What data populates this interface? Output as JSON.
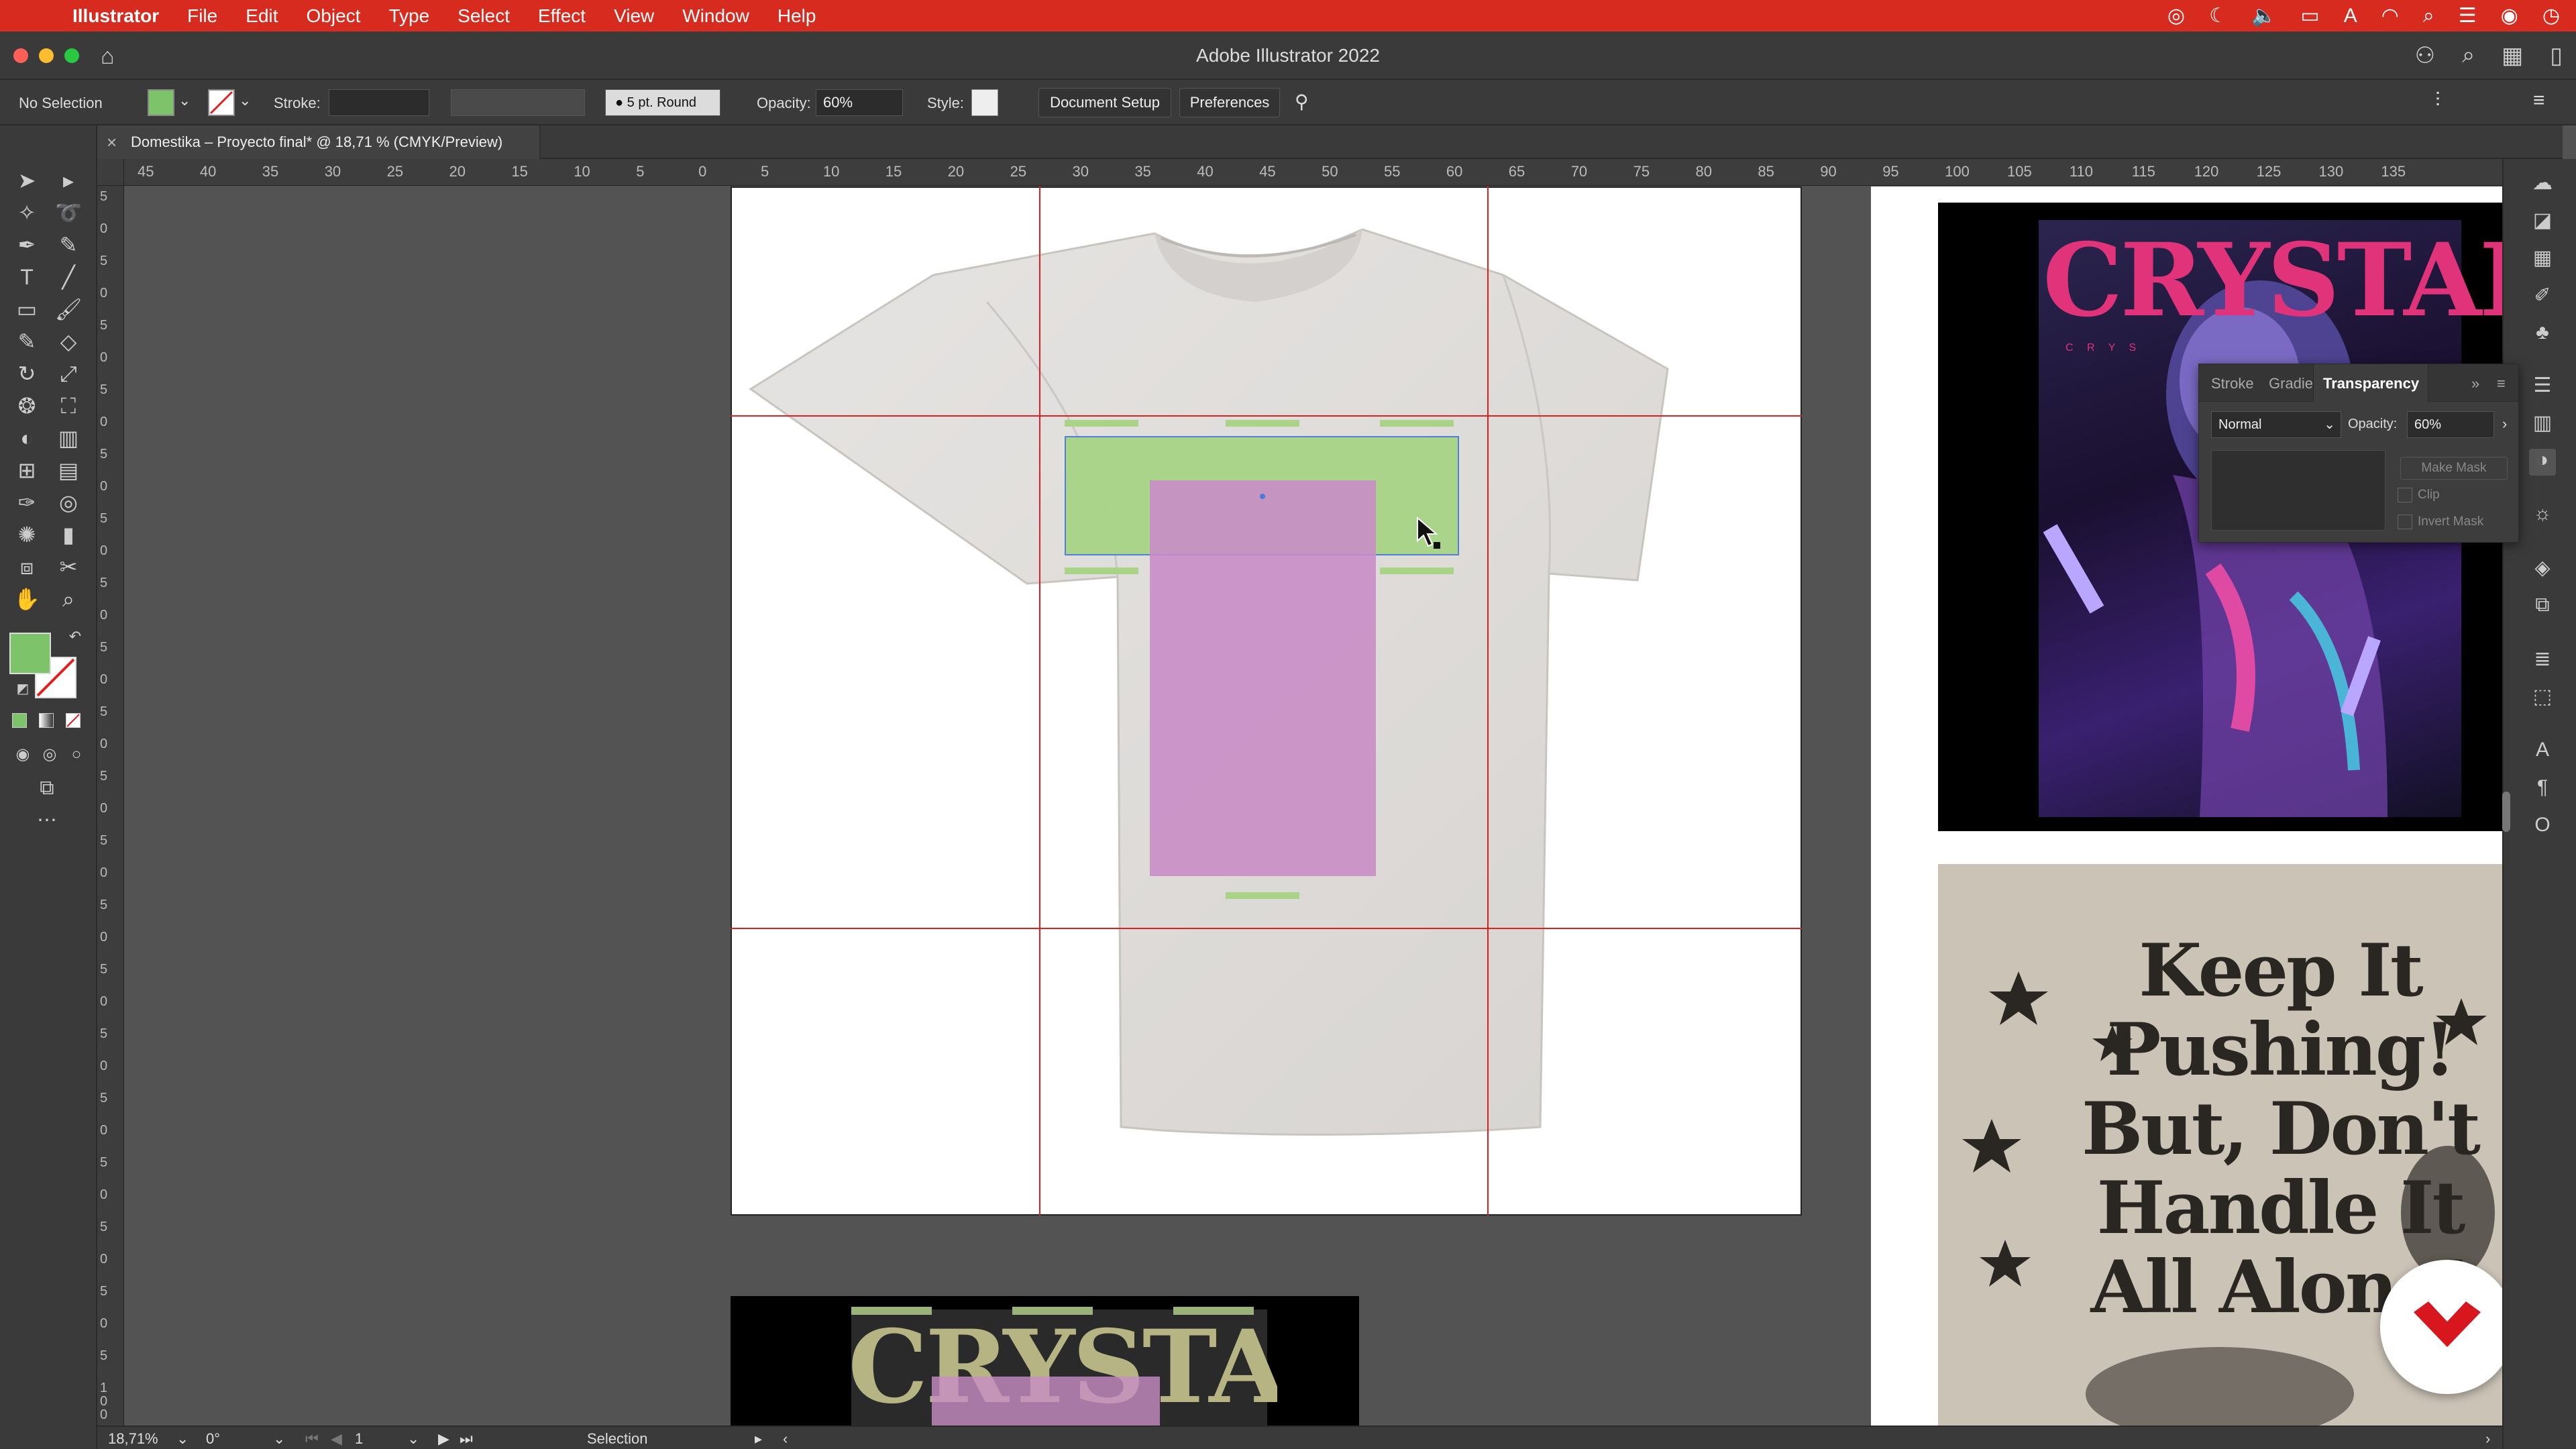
{
  "menubar": {
    "app_name": "Illustrator",
    "items": [
      "File",
      "Edit",
      "Object",
      "Type",
      "Select",
      "Effect",
      "View",
      "Window",
      "Help"
    ]
  },
  "window": {
    "title": "Adobe Illustrator 2022"
  },
  "control_bar": {
    "selection_label": "No Selection",
    "fill_color": "#7cc36a",
    "stroke_label": "Stroke:",
    "brush_label": "5 pt. Round",
    "opacity_label": "Opacity:",
    "opacity_value": "60%",
    "style_label": "Style:",
    "document_setup": "Document Setup",
    "preferences": "Preferences"
  },
  "document_tab": {
    "title": "Domestika – Proyecto final* @ 18,71 % (CMYK/Preview)"
  },
  "ruler_top": [
    "45",
    "40",
    "35",
    "30",
    "25",
    "20",
    "15",
    "10",
    "5",
    "0",
    "5",
    "10",
    "15",
    "20",
    "25",
    "30",
    "35",
    "40",
    "45",
    "50",
    "55",
    "60",
    "65",
    "70",
    "75",
    "80",
    "85",
    "90",
    "95",
    "100",
    "105",
    "110",
    "115",
    "120",
    "125",
    "130",
    "135"
  ],
  "ruler_left": [
    "5",
    "0",
    "5",
    "0",
    "5",
    "0",
    "5",
    "0",
    "5",
    "0",
    "5",
    "0",
    "5",
    "0",
    "5",
    "0",
    "5",
    "0",
    "5",
    "0",
    "5",
    "0",
    "5",
    "0",
    "5",
    "0",
    "5",
    "0",
    "5",
    "0",
    "5",
    "0",
    "5",
    "0",
    "5",
    "0",
    "5",
    "1 0 0"
  ],
  "transparency_panel": {
    "tabs": [
      "Stroke",
      "Gradie",
      "Transparency"
    ],
    "blend_mode": "Normal",
    "opacity_label": "Opacity:",
    "opacity_value": "60%",
    "make_mask": "Make Mask",
    "clip": "Clip",
    "invert_mask": "Invert Mask"
  },
  "posters": {
    "crystal_title": "CRYSTAL",
    "crystal_sub": "C R Y S",
    "keep_pushing_lines": [
      "Keep It",
      "Pushing!",
      "But, Don't",
      "Handle It",
      "All Alone!"
    ]
  },
  "statusbar": {
    "zoom": "18,71%",
    "rotation": "0°",
    "artboard": "1",
    "tool": "Selection"
  },
  "colors": {
    "menubar": "#d72b1f",
    "guide": "#e02020",
    "green_rect": "#a9d487",
    "pink_rect": "#c98dc6",
    "crystal_pink": "#e0337a"
  }
}
